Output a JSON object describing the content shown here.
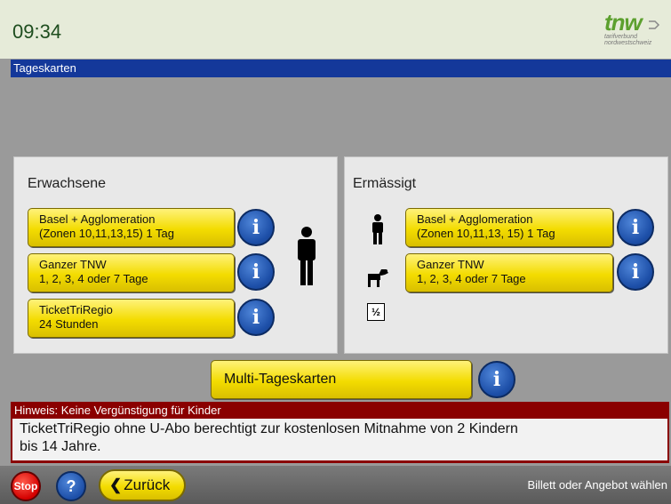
{
  "header": {
    "time": "09:34",
    "logo_word": "tnw",
    "logo_sub_1": "tarifverbund",
    "logo_sub_2": "nordwestschweiz"
  },
  "title_bar": {
    "label": "Tageskarten"
  },
  "adults_panel": {
    "title": "Erwachsene",
    "buttons": [
      {
        "line1": "Basel + Agglomeration",
        "line2": "(Zonen 10,11,13,15) 1 Tag"
      },
      {
        "line1": "Ganzer TNW",
        "line2": "1, 2, 3, 4 oder 7 Tage"
      },
      {
        "line1": "TicketTriRegio",
        "line2": "24 Stunden"
      }
    ],
    "info_symbol": "i",
    "icon": "adult-person-icon"
  },
  "reduced_panel": {
    "title": "Ermässigt",
    "buttons": [
      {
        "line1": "Basel + Agglomeration",
        "line2": "(Zonen 10,11,13, 15) 1 Tag"
      },
      {
        "line1": "Ganzer TNW",
        "line2": "1, 2, 3, 4 oder 7 Tage"
      }
    ],
    "icons": [
      "child-person-icon",
      "dog-icon",
      "half-fare-icon"
    ],
    "half_symbol": "½"
  },
  "multi": {
    "label": "Multi-Tageskarten"
  },
  "hint": {
    "title": "Hinweis: Keine Vergünstigung für Kinder",
    "line1": "TicketTriRegio ohne U-Abo berechtigt zur kostenlosen Mitnahme von 2 Kindern",
    "line2": "bis 14 Jahre."
  },
  "footer": {
    "stop_label": "Stop",
    "help_label": "?",
    "back_chevron": "❮",
    "back_label": "Zurück",
    "status": "Billett oder Angebot wählen"
  },
  "colors": {
    "title_bar": "#14389a",
    "button_yellow": "#f3dc00",
    "info_blue": "#1d4fa8",
    "hint_red": "#8a0000",
    "stop_red": "#d40000",
    "logo_green": "#5ca02e"
  }
}
